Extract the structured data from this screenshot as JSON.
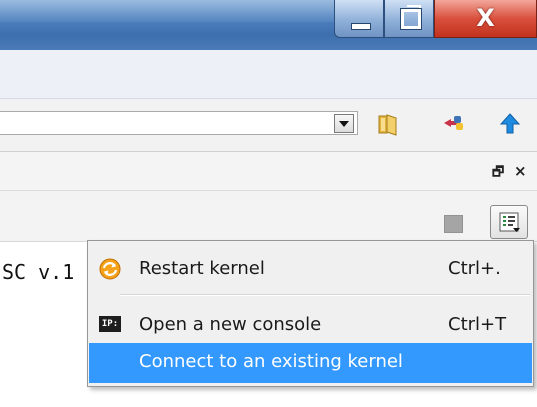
{
  "window_controls": {
    "minimize_icon": "minimize-icon",
    "maximize_icon": "restore-icon",
    "close_label": "X"
  },
  "toolbar": {
    "icons": [
      "folder-icon",
      "python-path-icon",
      "up-arrow-icon"
    ]
  },
  "pane": {
    "undock_glyph": "🗗",
    "close_glyph": "×"
  },
  "console": {
    "text": "SC v.1"
  },
  "menu": {
    "items": [
      {
        "label": "Restart kernel",
        "shortcut": "Ctrl+.",
        "icon": "restart-kernel-icon"
      },
      {
        "label": "Open a new console",
        "shortcut": "Ctrl+T",
        "icon": "ipython-console-icon",
        "icon_text": "IP:"
      },
      {
        "label": "Connect to an existing kernel",
        "shortcut": "",
        "highlighted": true
      }
    ]
  },
  "colors": {
    "highlight": "#3399ff",
    "close_button": "#d9503d",
    "titlebar": "#4f82c0"
  }
}
